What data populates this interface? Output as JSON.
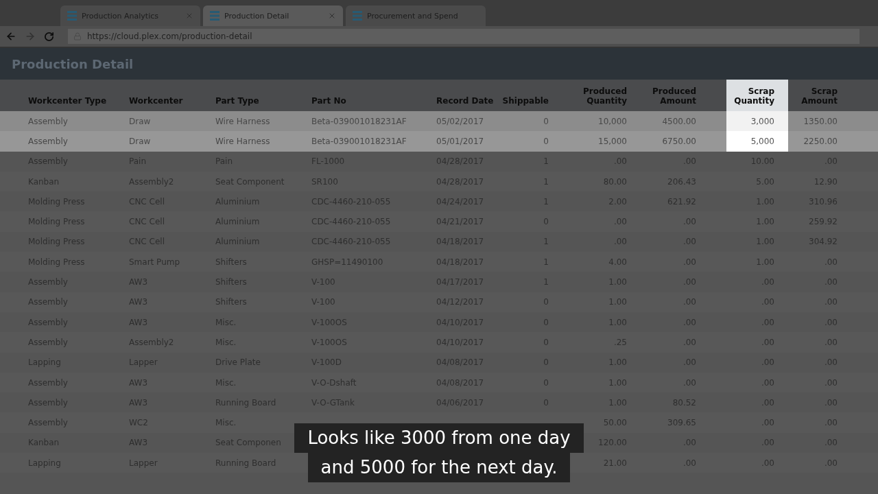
{
  "browser": {
    "tabs": [
      {
        "title": "Production Analytics",
        "selected": false,
        "closable": true
      },
      {
        "title": "Production Detail",
        "selected": true,
        "closable": true
      },
      {
        "title": "Procurement and Spend",
        "selected": false,
        "closable": false
      }
    ],
    "url": "https://cloud.plex.com/production-detail"
  },
  "page": {
    "title": "Production Detail"
  },
  "table": {
    "columns": [
      {
        "label": "Workcenter Type",
        "highlighted": false
      },
      {
        "label": "Workcenter",
        "highlighted": false
      },
      {
        "label": "Part Type",
        "highlighted": false
      },
      {
        "label": "Part No",
        "highlighted": false
      },
      {
        "label": "Record Date",
        "highlighted": false
      },
      {
        "label": "Shippable",
        "highlighted": false
      },
      {
        "label": "Produced Quantity",
        "highlighted": false
      },
      {
        "label": "Produced Amount",
        "highlighted": false
      },
      {
        "label": "Scrap Quantity",
        "highlighted": true
      },
      {
        "label": "Scrap Amount",
        "highlighted": false
      }
    ],
    "rows": [
      {
        "highlighted": true,
        "workcenter_type": "Assembly",
        "workcenter": "Draw",
        "part_type": "Wire Harness",
        "part_no": "Beta-039001018231AF",
        "record_date": "05/02/2017",
        "shippable": "0",
        "produced_quantity": "10,000",
        "produced_amount": "4500.00",
        "scrap_quantity": "3,000",
        "scrap_amount": "1350.00"
      },
      {
        "highlighted": true,
        "workcenter_type": "Assembly",
        "workcenter": "Draw",
        "part_type": "Wire Harness",
        "part_no": "Beta-039001018231AF",
        "record_date": "05/01/2017",
        "shippable": "0",
        "produced_quantity": "15,000",
        "produced_amount": "6750.00",
        "scrap_quantity": "5,000",
        "scrap_amount": "2250.00"
      },
      {
        "highlighted": false,
        "workcenter_type": "Assembly",
        "workcenter": "Pain",
        "part_type": "Pain",
        "part_no": "FL-1000",
        "record_date": "04/28/2017",
        "shippable": "1",
        "produced_quantity": ".00",
        "produced_amount": ".00",
        "scrap_quantity": "10.00",
        "scrap_amount": ".00"
      },
      {
        "highlighted": false,
        "workcenter_type": "Kanban",
        "workcenter": "Assembly2",
        "part_type": "Seat Component",
        "part_no": "SR100",
        "record_date": "04/28/2017",
        "shippable": "1",
        "produced_quantity": "80.00",
        "produced_amount": "206.43",
        "scrap_quantity": "5.00",
        "scrap_amount": "12.90"
      },
      {
        "highlighted": false,
        "workcenter_type": "Molding Press",
        "workcenter": "CNC Cell",
        "part_type": "Aluminium",
        "part_no": "CDC-4460-210-055",
        "record_date": "04/24/2017",
        "shippable": "1",
        "produced_quantity": "2.00",
        "produced_amount": "621.92",
        "scrap_quantity": "1.00",
        "scrap_amount": "310.96"
      },
      {
        "highlighted": false,
        "workcenter_type": "Molding Press",
        "workcenter": "CNC Cell",
        "part_type": "Aluminium",
        "part_no": "CDC-4460-210-055",
        "record_date": "04/21/2017",
        "shippable": "0",
        "produced_quantity": ".00",
        "produced_amount": ".00",
        "scrap_quantity": "1.00",
        "scrap_amount": "259.92"
      },
      {
        "highlighted": false,
        "workcenter_type": "Molding Press",
        "workcenter": "CNC Cell",
        "part_type": "Aluminium",
        "part_no": "CDC-4460-210-055",
        "record_date": "04/18/2017",
        "shippable": "1",
        "produced_quantity": ".00",
        "produced_amount": ".00",
        "scrap_quantity": "1.00",
        "scrap_amount": "304.92"
      },
      {
        "highlighted": false,
        "workcenter_type": "Molding Press",
        "workcenter": "Smart Pump",
        "part_type": "Shifters",
        "part_no": "GHSP=11490100",
        "record_date": "04/18/2017",
        "shippable": "1",
        "produced_quantity": "4.00",
        "produced_amount": ".00",
        "scrap_quantity": "1.00",
        "scrap_amount": ".00"
      },
      {
        "highlighted": false,
        "workcenter_type": "Assembly",
        "workcenter": "AW3",
        "part_type": "Shifters",
        "part_no": "V-100",
        "record_date": "04/17/2017",
        "shippable": "1",
        "produced_quantity": "1.00",
        "produced_amount": ".00",
        "scrap_quantity": ".00",
        "scrap_amount": ".00"
      },
      {
        "highlighted": false,
        "workcenter_type": "Assembly",
        "workcenter": "AW3",
        "part_type": "Shifters",
        "part_no": "V-100",
        "record_date": "04/12/2017",
        "shippable": "0",
        "produced_quantity": "1.00",
        "produced_amount": ".00",
        "scrap_quantity": ".00",
        "scrap_amount": ".00"
      },
      {
        "highlighted": false,
        "workcenter_type": "Assembly",
        "workcenter": "AW3",
        "part_type": "Misc.",
        "part_no": "V-100OS",
        "record_date": "04/10/2017",
        "shippable": "0",
        "produced_quantity": "1.00",
        "produced_amount": ".00",
        "scrap_quantity": ".00",
        "scrap_amount": ".00"
      },
      {
        "highlighted": false,
        "workcenter_type": "Assembly",
        "workcenter": "Assembly2",
        "part_type": "Misc.",
        "part_no": "V-100OS",
        "record_date": "04/10/2017",
        "shippable": "0",
        "produced_quantity": ".25",
        "produced_amount": ".00",
        "scrap_quantity": ".00",
        "scrap_amount": ".00"
      },
      {
        "highlighted": false,
        "workcenter_type": "Lapping",
        "workcenter": "Lapper",
        "part_type": "Drive Plate",
        "part_no": "V-100D",
        "record_date": "04/08/2017",
        "shippable": "0",
        "produced_quantity": "1.00",
        "produced_amount": ".00",
        "scrap_quantity": ".00",
        "scrap_amount": ".00"
      },
      {
        "highlighted": false,
        "workcenter_type": "Assembly",
        "workcenter": "AW3",
        "part_type": "Misc.",
        "part_no": "V-O-Dshaft",
        "record_date": "04/08/2017",
        "shippable": "0",
        "produced_quantity": "1.00",
        "produced_amount": ".00",
        "scrap_quantity": ".00",
        "scrap_amount": ".00"
      },
      {
        "highlighted": false,
        "workcenter_type": "Assembly",
        "workcenter": "AW3",
        "part_type": "Running Board",
        "part_no": "V-O-GTank",
        "record_date": "04/06/2017",
        "shippable": "0",
        "produced_quantity": "1.00",
        "produced_amount": "80.52",
        "scrap_quantity": ".00",
        "scrap_amount": ".00"
      },
      {
        "highlighted": false,
        "workcenter_type": "Assembly",
        "workcenter": "WC2",
        "part_type": "Misc.",
        "produced_quantity": "50.00",
        "produced_amount": "309.65",
        "scrap_quantity": ".00",
        "scrap_amount": ".00"
      },
      {
        "highlighted": false,
        "workcenter_type": "Kanban",
        "workcenter": "AW3",
        "part_type": "Seat Componen",
        "produced_quantity": "120.00",
        "produced_amount": ".00",
        "scrap_quantity": ".00",
        "scrap_amount": ".00"
      },
      {
        "highlighted": false,
        "workcenter_type": "Lapping",
        "workcenter": "Lapper",
        "part_type": "Running Board",
        "produced_quantity": "21.00",
        "produced_amount": ".00",
        "scrap_quantity": ".00",
        "scrap_amount": ".00"
      }
    ]
  },
  "caption": {
    "lines": [
      "Looks like 3000 from one day",
      "and 5000 for the next day."
    ]
  }
}
